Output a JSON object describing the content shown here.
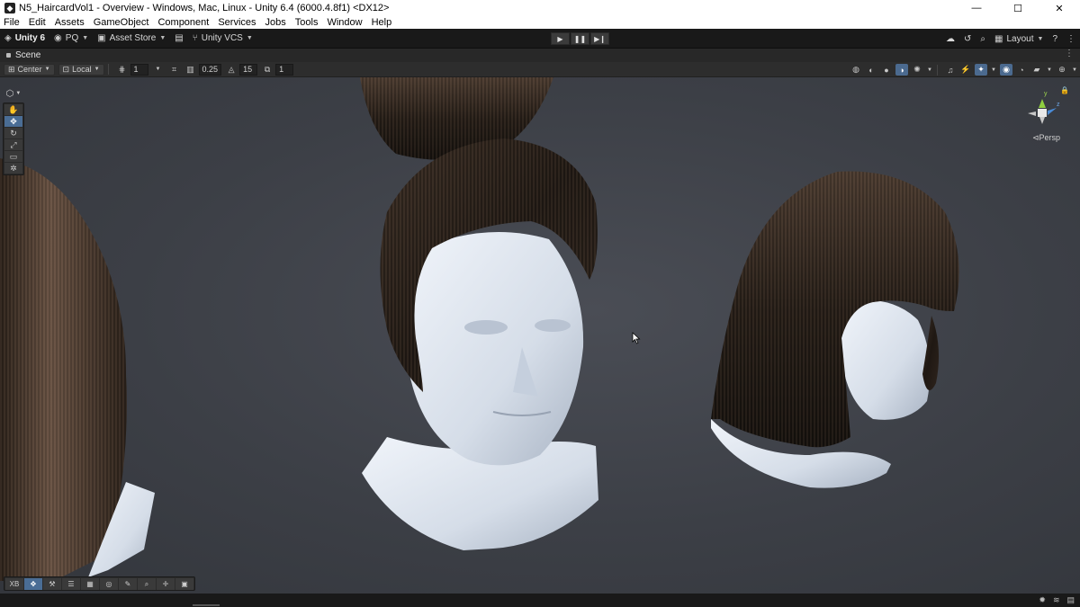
{
  "window": {
    "title": "N5_HaircardVol1 - Overview - Windows, Mac, Linux - Unity 6.4 (6000.4.8f1) <DX12>",
    "controls": {
      "minimize": "—",
      "maximize": "☐",
      "close": "✕"
    }
  },
  "menu": [
    "File",
    "Edit",
    "Assets",
    "GameObject",
    "Component",
    "Services",
    "Jobs",
    "Tools",
    "Window",
    "Help"
  ],
  "toolbar": {
    "unity_label": "Unity 6",
    "account_label": "PQ",
    "asset_store_label": "Asset Store",
    "vcs_label": "Unity VCS",
    "layout_label": "Layout",
    "play_icons": {
      "play": "▶",
      "pause": "❚❚",
      "step": "▶❙"
    },
    "right_icons": [
      "cloud-icon",
      "history-icon",
      "search-icon",
      "layout-icon",
      "help-icon",
      "more-icon"
    ]
  },
  "scene_tab": {
    "label": "Scene",
    "more": "⋮"
  },
  "scene_toolbar": {
    "pivot_label": "Center",
    "space_label": "Local",
    "grid_value": "1",
    "snap_value": "0.25",
    "rotate_snap_value": "15",
    "scale_snap_value": "1"
  },
  "gizmo": {
    "y_label": "y",
    "z_label": "z",
    "projection_label": "Persp"
  },
  "tools": [
    {
      "name": "view-tool",
      "glyph": "✋",
      "active": false
    },
    {
      "name": "move-tool",
      "glyph": "✥",
      "active": true
    },
    {
      "name": "rotate-tool",
      "glyph": "↻",
      "active": false
    },
    {
      "name": "scale-tool",
      "glyph": "⤢",
      "active": false
    },
    {
      "name": "rect-tool",
      "glyph": "▭",
      "active": false
    },
    {
      "name": "transform-tool",
      "glyph": "✲",
      "active": false
    }
  ],
  "overlay_toolbar": {
    "first_label": "XB"
  },
  "colors": {
    "accent": "#4a6d95",
    "skin": "#dde4ee",
    "hair_dark": "#2a211b",
    "hair_light": "#6b5445",
    "viewport_bg": "#3c3f46"
  }
}
